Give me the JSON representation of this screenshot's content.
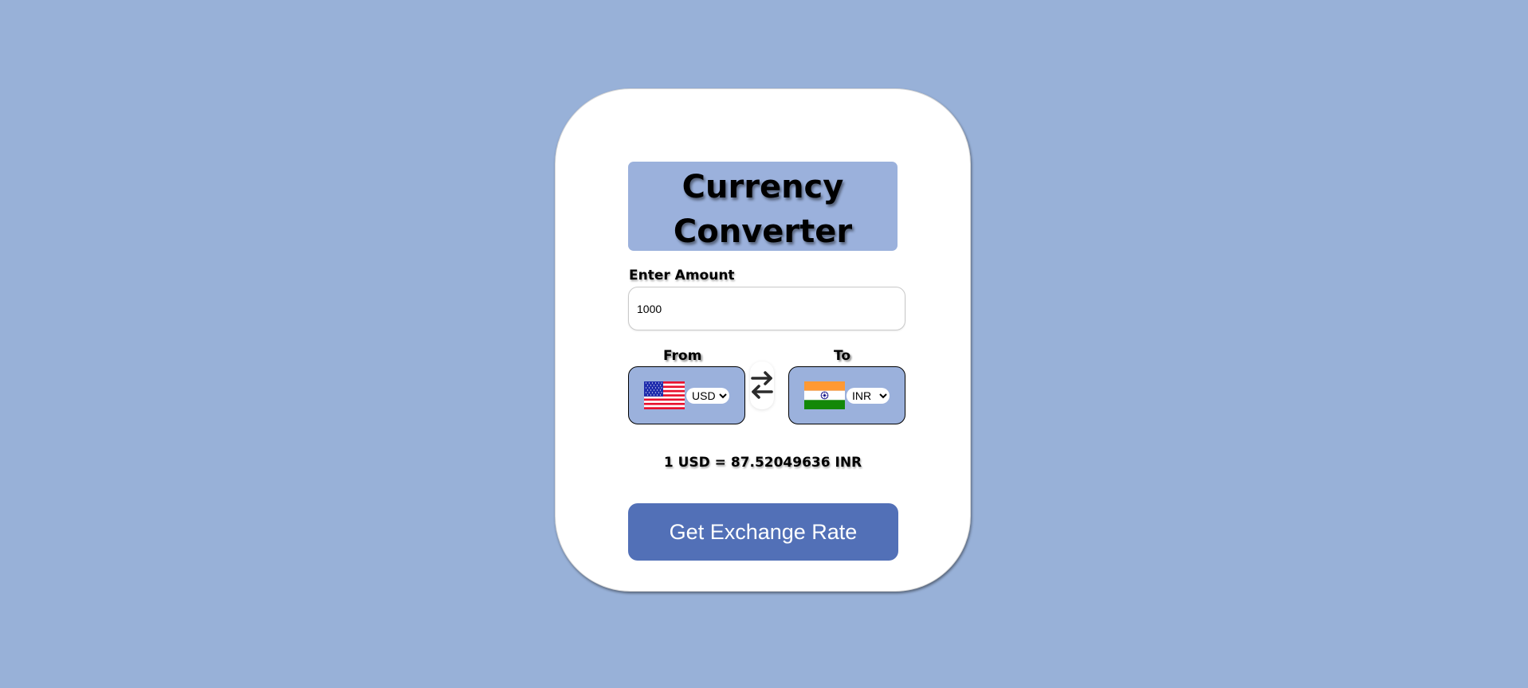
{
  "title_line1": "Currency",
  "title_line2": "Converter",
  "amount": {
    "label": "Enter Amount",
    "value": "1000"
  },
  "from": {
    "label": "From",
    "flag_icon": "us-flag-icon",
    "selected": "USD"
  },
  "to": {
    "label": "To",
    "flag_icon": "india-flag-icon",
    "selected": "INR"
  },
  "swap_icon": "swap-arrows-icon",
  "rate_message": "1 USD = 87.52049636 INR",
  "button_label": "Get Exchange Rate",
  "colors": {
    "background": "#98b1d8",
    "title_box": "#9bb1dc",
    "button": "#5270b7"
  }
}
